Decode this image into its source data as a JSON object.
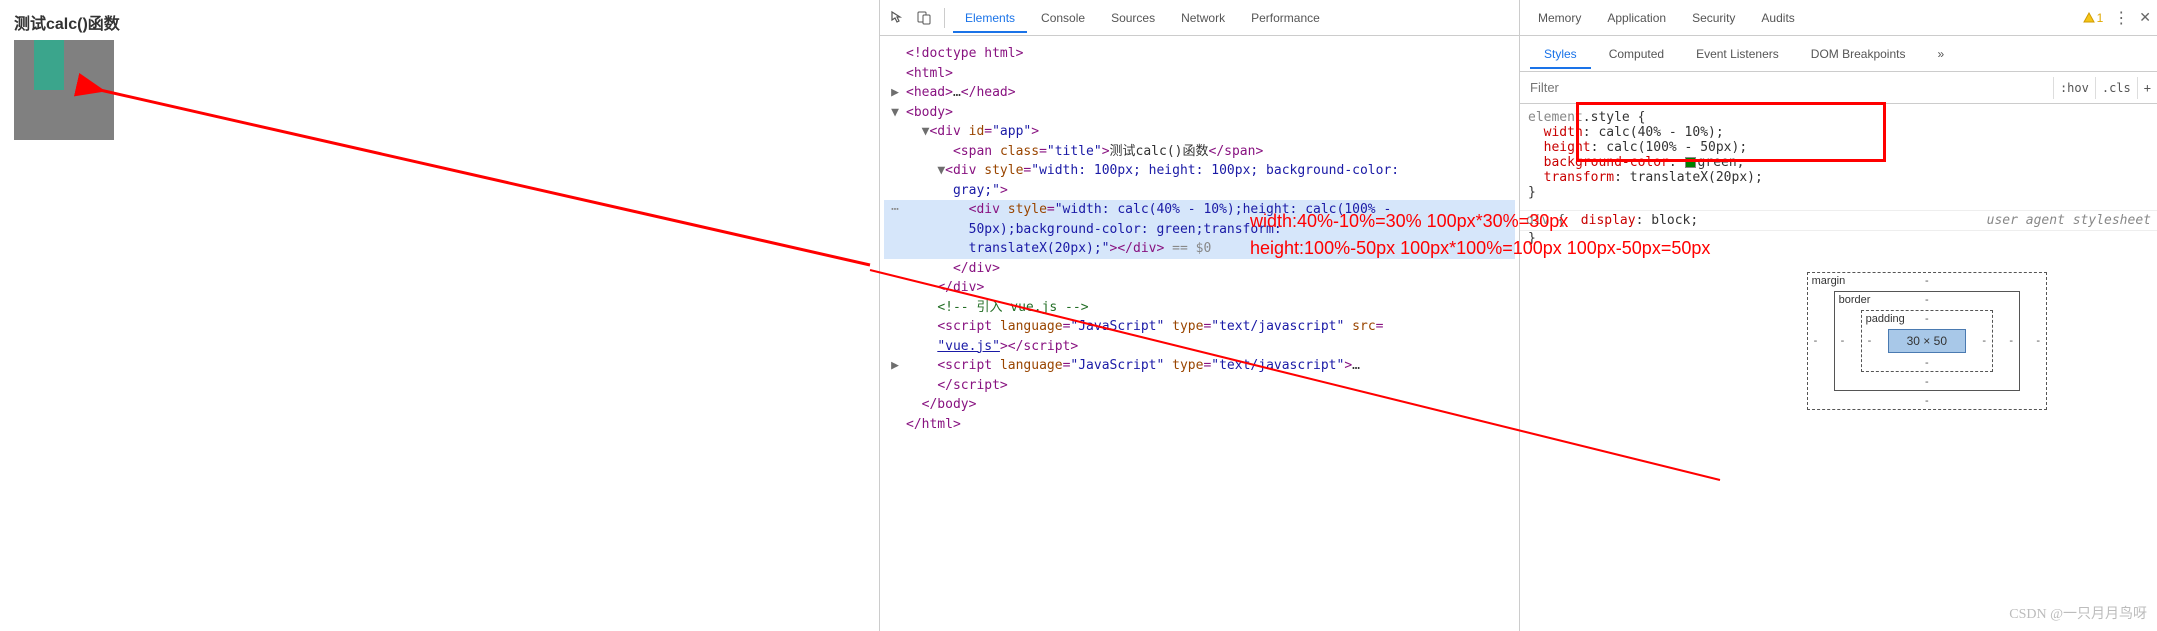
{
  "page": {
    "title": "测试calc()函数",
    "outer_style": "width: 100px; height: 100px; background-color: gray;",
    "inner_style": "width: calc(40% - 10%);height: calc(100% - 50px);background-color: green;transform: translateX(20px);"
  },
  "devtools": {
    "tabs": [
      "Elements",
      "Console",
      "Sources",
      "Network",
      "Performance",
      "Memory",
      "Application",
      "Security",
      "Audits"
    ],
    "active_tab": "Elements",
    "warn_count": "1",
    "sub_tabs": [
      "Styles",
      "Computed",
      "Event Listeners",
      "DOM Breakpoints"
    ],
    "active_sub_tab": "Styles",
    "filter_placeholder": "Filter",
    "hov_label": ":hov",
    "cls_label": ".cls",
    "plus_label": "+"
  },
  "dom": {
    "doctype": "<!doctype html>",
    "html_open": "<html>",
    "head_line": "<head>…</head>",
    "body_open": "<body>",
    "app_open": "<div id=\"app\">",
    "span_line_1": "<span class=\"title\">",
    "span_text": "测试calc()函数",
    "span_line_2": "</span>",
    "outer_open": "<div style=\"width: 100px; height: 100px; background-color: gray;\">",
    "ellipsis": "…",
    "inner_1": "<div style=\"width: calc(40% - 10%);height: calc(100% - ",
    "inner_2": "50px);background-color: green;transform: ",
    "inner_3": "translateX(20px);\"></div>",
    "eqdollar": " == $0",
    "div_close1": "</div>",
    "div_close2": "</div>",
    "comment": "<!-- 引入 vue.js -->",
    "script1a": "<script language=\"JavaScript\" type=\"text/javascript\" src=",
    "script1b": "\"vue.js\"></scr",
    "script1c": "ipt>",
    "script2": "<script language=\"JavaScript\" type=\"text/javascript\">…",
    "script_close": "</scr",
    "script_close2": "ipt>",
    "body_close": "</body>",
    "html_close": "</html>"
  },
  "styles": {
    "selector": "element.style {",
    "p_width": "width",
    "v_width": ": calc(40% - 10%);",
    "p_height": "height",
    "v_height": ": calc(100% - 50px);",
    "p_bg": "background-color",
    "v_bg": "green;",
    "p_tf": "transform",
    "v_tf": ": translateX(20px);",
    "close": "}",
    "ua_sel": "div {",
    "ua_prop": "display",
    "ua_val": ": block;",
    "ua_label": "user agent stylesheet"
  },
  "annotations": {
    "line1": "width:40%-10%=30% 100px*30%=30px",
    "line2": "height:100%-50px 100px*100%=100px 100px-50px=50px"
  },
  "boxmodel": {
    "margin": "margin",
    "border": "border",
    "padding": "padding",
    "core": "30 × 50",
    "dash": "-"
  },
  "watermark": "CSDN @一只月月鸟呀"
}
